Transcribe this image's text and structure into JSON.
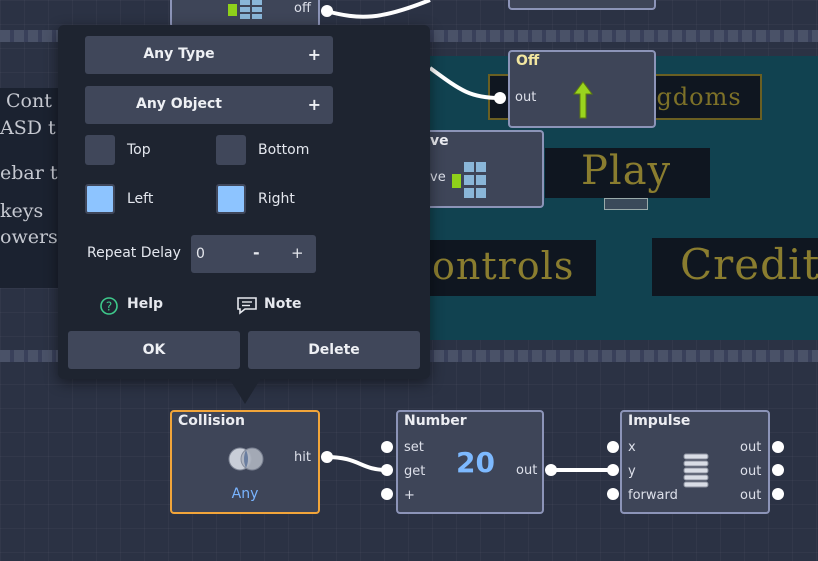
{
  "background_scene": {
    "kingdoms_text": "ngdoms",
    "play_text": "Play",
    "controls_text": "ontrols",
    "credits_text": "Credits",
    "left_lines": [
      "Cont",
      "ASD t",
      "ebar t",
      "keys",
      "owers"
    ]
  },
  "top_nodes": {
    "off_port_label": "off",
    "off_node": {
      "title": "Off",
      "out_label": "out"
    },
    "partial_node": {
      "title": "ve",
      "port_label": "ve"
    }
  },
  "popup": {
    "type_dropdown": {
      "label": "Any Type",
      "plus": "+"
    },
    "object_dropdown": {
      "label": "Any Object",
      "plus": "+"
    },
    "checkboxes": [
      {
        "label": "Top",
        "checked": false
      },
      {
        "label": "Bottom",
        "checked": false
      },
      {
        "label": "Left",
        "checked": true
      },
      {
        "label": "Right",
        "checked": true
      }
    ],
    "repeat_delay": {
      "label": "Repeat Delay",
      "value": "0",
      "minus": "-",
      "plus": "+"
    },
    "help_label": "Help",
    "note_label": "Note",
    "ok_label": "OK",
    "delete_label": "Delete"
  },
  "nodes": {
    "collision": {
      "title": "Collision",
      "port_hit": "hit",
      "subtitle": "Any"
    },
    "number": {
      "title": "Number",
      "value": "20",
      "in_ports": [
        "set",
        "get",
        "+"
      ],
      "out_label": "out"
    },
    "impulse": {
      "title": "Impulse",
      "in_ports": [
        "x",
        "y",
        "forward"
      ],
      "out_ports": [
        "out",
        "out",
        "out"
      ]
    }
  },
  "colors": {
    "accent_selected": "#f2a53a",
    "checkbox_on": "#8dc4ff",
    "number_value": "#7db9ff",
    "any_text": "#79b4ff"
  }
}
